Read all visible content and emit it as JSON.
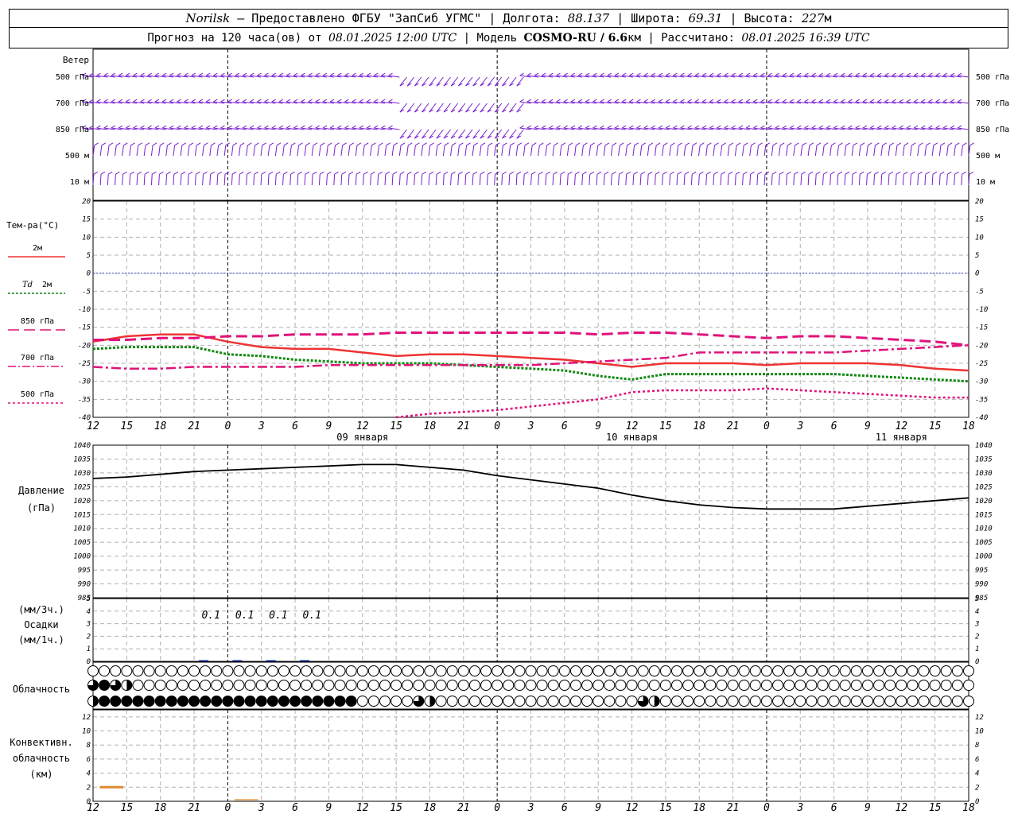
{
  "header": {
    "station": "Norilsk",
    "provider": " – Предоставлено ФГБУ \"ЗапСиб УГМС\" | Долгота: ",
    "lon": "88.137",
    "lat_label": " | Широта: ",
    "lat": "69.31",
    "alt_label": " | Высота: ",
    "alt": "227",
    "alt_unit": "м",
    "forecast_label": "Прогноз на 120 часа(ов) от ",
    "start": "08.01.2025 12:00 UTC",
    "model_label": " | Модель ",
    "model": "COSMO-RU / 6.6",
    "model_unit": "км",
    "calc_label": " | Рассчитано: ",
    "calc": "08.01.2025 16:39 UTC"
  },
  "labels": {
    "wind": "Ветер",
    "wind_levels": [
      "500 гПа",
      "700 гПа",
      "850 гПа",
      "500 м",
      "10 м"
    ],
    "temp": "Тем-ра(°С)",
    "t2m": "2м",
    "td": "Td",
    "td2m": "2м",
    "t850": "850 гПа",
    "t700": "700 гПа",
    "t500": "500 гПа",
    "pressure": "Давление",
    "pressure_unit": "(гПа)",
    "precip_3h": "(мм/3ч.)",
    "precip": "Осадки",
    "precip_1h": "(мм/1ч.)",
    "cloud": "Облачность",
    "conv1": "Конвективн.",
    "conv2": "облачность",
    "conv3": "(км)"
  },
  "colors": {
    "wind": "#7a1fd0",
    "t2m": "#ee3333",
    "td": "#118811",
    "upper": "#e0127a",
    "zero": "#3344cc",
    "pressure": "#000000",
    "precip": "#1133aa",
    "conv": "#e08a30",
    "grid": "#b0b0b0"
  },
  "chart_data": {
    "type": "line",
    "x_hours": [
      12,
      15,
      18,
      21,
      0,
      3,
      6,
      9,
      12,
      15,
      18,
      21,
      0,
      3,
      6,
      9,
      12,
      15,
      18,
      21,
      0,
      3,
      6,
      9,
      12,
      15,
      18
    ],
    "day_labels": [
      {
        "label": "09 января",
        "hour_index": 8
      },
      {
        "label": "10 января",
        "hour_index": 16
      },
      {
        "label": "11 января",
        "hour_index": 24
      }
    ],
    "temperature": {
      "ylim": [
        -40,
        20
      ],
      "ticks": [
        20,
        15,
        10,
        5,
        0,
        -5,
        -10,
        -15,
        -20,
        -25,
        -30,
        -35,
        -40
      ],
      "series": [
        {
          "name": "2м",
          "key": "t2m",
          "values": [
            -19,
            -17.5,
            -17,
            -17,
            -19,
            -20.5,
            -21,
            -21,
            -22,
            -23,
            -22.5,
            -22.5,
            -23,
            -23.5,
            -24,
            -25,
            -26,
            -25,
            -25,
            -25,
            -25.5,
            -25,
            -25,
            -25,
            -25.5,
            -26.5,
            -27
          ]
        },
        {
          "name": "Td 2м",
          "key": "td",
          "values": [
            -21,
            -20.5,
            -20.5,
            -20.5,
            -22.5,
            -23,
            -24,
            -24.5,
            -25,
            -25,
            -25,
            -25.5,
            -26,
            -26.5,
            -27,
            -28.5,
            -29.5,
            -28,
            -28,
            -28,
            -28,
            -28,
            -28,
            -28.5,
            -29,
            -29.5,
            -30
          ]
        },
        {
          "name": "850 гПа",
          "key": "t850",
          "values": [
            -18.5,
            -18.5,
            -18,
            -18,
            -17.5,
            -17.5,
            -17,
            -17,
            -17,
            -16.5,
            -16.5,
            -16.5,
            -16.5,
            -16.5,
            -16.5,
            -17,
            -16.5,
            -16.5,
            -17,
            -17.5,
            -18,
            -17.5,
            -17.5,
            -18,
            -18.5,
            -19,
            -20
          ]
        },
        {
          "name": "700 гПа",
          "key": "t700",
          "values": [
            -26,
            -26.5,
            -26.5,
            -26,
            -26,
            -26,
            -26,
            -25.5,
            -25.5,
            -25.5,
            -25.5,
            -25.5,
            -25.5,
            -25.5,
            -25,
            -24.5,
            -24,
            -23.5,
            -22,
            -22,
            -22,
            -22,
            -22,
            -21.5,
            -21,
            -20.5,
            -20
          ]
        },
        {
          "name": "500 гПа",
          "key": "t500",
          "values": [
            null,
            null,
            null,
            null,
            null,
            null,
            null,
            null,
            null,
            -40,
            -39,
            -38.5,
            -38,
            -37,
            -36,
            -35,
            -33,
            -32.5,
            -32.5,
            -32.5,
            -32,
            -32.5,
            -33,
            -33.5,
            -34,
            -34.5,
            -34.5
          ]
        }
      ]
    },
    "pressure": {
      "ylim": [
        985,
        1040
      ],
      "ticks": [
        1040,
        1035,
        1030,
        1025,
        1020,
        1015,
        1010,
        1005,
        1000,
        995,
        990,
        985
      ],
      "values": [
        1028,
        1028.5,
        1029.5,
        1030.5,
        1031,
        1031.5,
        1032,
        1032.5,
        1033,
        1033,
        1032,
        1031,
        1029,
        1027.5,
        1026,
        1024.5,
        1022,
        1020,
        1018.5,
        1017.5,
        1017,
        1017,
        1017,
        1018,
        1019,
        1020,
        1021
      ]
    },
    "precipitation": {
      "ylim": [
        0,
        5
      ],
      "ticks": [
        5,
        4,
        3,
        2,
        1,
        0
      ],
      "labels": [
        {
          "text": "0.1",
          "hour_index": 3.5
        },
        {
          "text": "0.1",
          "hour_index": 4.5
        },
        {
          "text": "0.1",
          "hour_index": 5.5
        },
        {
          "text": "0.1",
          "hour_index": 6.5
        }
      ],
      "amounts_mm": [
        {
          "from_index": 3,
          "to_index": 4,
          "value": 0.1
        },
        {
          "from_index": 4,
          "to_index": 5,
          "value": 0.1
        },
        {
          "from_index": 5,
          "to_index": 6,
          "value": 0.1
        },
        {
          "from_index": 6,
          "to_index": 7,
          "value": 0.1
        }
      ]
    },
    "cloud_rows": [
      {
        "row": "high",
        "cover": [
          0,
          0,
          0,
          0,
          0,
          0,
          0,
          0,
          0,
          0,
          0,
          0,
          0,
          0,
          0,
          0,
          0,
          0,
          0,
          0,
          0,
          0,
          0,
          0,
          0,
          0,
          0,
          0,
          0,
          0,
          0,
          0,
          0,
          0,
          0,
          0,
          0,
          0,
          0,
          0,
          0,
          0,
          0,
          0,
          0,
          0,
          0,
          0,
          0,
          0,
          0,
          0,
          0,
          0,
          0,
          0,
          0,
          0,
          0,
          0,
          0,
          0,
          0,
          0,
          0,
          0,
          0,
          0,
          0,
          0,
          0,
          0,
          0,
          0,
          0,
          0,
          0,
          0,
          0,
          0,
          0,
          0,
          0,
          0,
          0,
          0,
          0,
          0,
          0,
          0,
          0,
          0,
          0,
          0,
          0,
          0,
          0,
          0,
          0,
          0,
          0,
          0,
          0,
          0,
          0,
          0,
          0,
          0,
          0,
          0,
          0,
          0,
          0,
          0,
          0,
          0,
          0,
          0,
          0,
          0,
          0
        ]
      },
      {
        "row": "middle",
        "cover": [
          0.75,
          1,
          0.75,
          0.5,
          0,
          0,
          0,
          0,
          0,
          0,
          0,
          0,
          0,
          0,
          0,
          0,
          0,
          0,
          0,
          0,
          0,
          0,
          0,
          0,
          0,
          0,
          0,
          0,
          0,
          0,
          0,
          0,
          0,
          0,
          0,
          0,
          0,
          0,
          0,
          0,
          0,
          0,
          0,
          0,
          0,
          0,
          0,
          0,
          0,
          0,
          0,
          0,
          0,
          0,
          0,
          0,
          0,
          0,
          0,
          0,
          0,
          0,
          0,
          0,
          0,
          0,
          0,
          0,
          0,
          0,
          0,
          0,
          0,
          0,
          0,
          0,
          0,
          0,
          0,
          0,
          0,
          0,
          0,
          0,
          0,
          0,
          0,
          0,
          0,
          0,
          0,
          0,
          0,
          0,
          0,
          0,
          0,
          0,
          0,
          0,
          0,
          0,
          0,
          0,
          0,
          0,
          0,
          0,
          0,
          0,
          0,
          0,
          0,
          0,
          0,
          0,
          0,
          0,
          0,
          0,
          0
        ]
      },
      {
        "row": "low",
        "cover": [
          0.5,
          1,
          1,
          1,
          1,
          1,
          1,
          1,
          1,
          1,
          1,
          1,
          1,
          1,
          1,
          1,
          1,
          1,
          1,
          1,
          1,
          1,
          1,
          1,
          0,
          0,
          0,
          0,
          0,
          0.75,
          0.5,
          0,
          0,
          0,
          0,
          0,
          0,
          0,
          0,
          0,
          0,
          0,
          0,
          0,
          0,
          0,
          0,
          0,
          0,
          0.75,
          0.5,
          0,
          0,
          0,
          0,
          0,
          0,
          0,
          0,
          0,
          0,
          0,
          0,
          0,
          0,
          0,
          0,
          0,
          0,
          0,
          0,
          0,
          0,
          0,
          0,
          0,
          0,
          0,
          0,
          0,
          0,
          0,
          0,
          0,
          0,
          0,
          0,
          0,
          0,
          0,
          0,
          0,
          0,
          0,
          0,
          0,
          0,
          0,
          0,
          0,
          0,
          0,
          0,
          0,
          0,
          0,
          0,
          0,
          0,
          0,
          0,
          0,
          0,
          0,
          0,
          0,
          0,
          0,
          0,
          0,
          0
        ]
      }
    ],
    "convective_cloud": {
      "ylim": [
        0,
        13
      ],
      "ticks": [
        12,
        10,
        8,
        6,
        4,
        2,
        0
      ],
      "segments": [
        {
          "from_index": 0.2,
          "to_index": 0.9,
          "top_km": 2
        },
        {
          "from_index": 4.2,
          "to_index": 4.9,
          "top_km": 0
        }
      ]
    },
    "wind": {
      "levels": [
        "500 гПа",
        "700 гПа",
        "850 гПа",
        "500 м",
        "10 м"
      ]
    }
  }
}
